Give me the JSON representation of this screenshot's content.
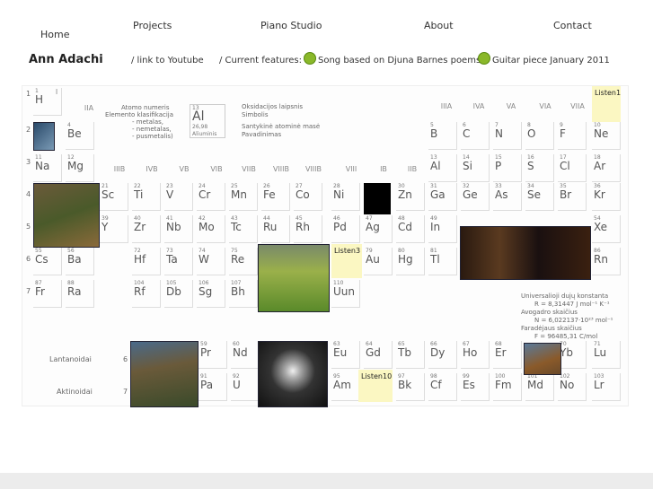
{
  "nav": {
    "home": "Home",
    "projects": "Projects",
    "piano": "Piano Studio",
    "about": "About",
    "contact": "Contact"
  },
  "header": {
    "name": "Ann Adachi",
    "youtube": "/ link to Youtube",
    "features_label": "/ Current features:",
    "feature1": "Song based on Djuna Barnes poems",
    "feature2": "Guitar piece January 2011"
  },
  "legend": {
    "atomic_number": "Atomo numeris",
    "classification": "Elemento klasifikacija",
    "metals": "- metalas,",
    "nonmetals": "- nemetalas,",
    "semimetals": "- pusmetalis)",
    "oxidation": "Oksidacijos laipsnis",
    "symbol_label": "Simbolis",
    "mass": "Santykinė atominė masė",
    "name_label": "Pavadinimas",
    "sample_symbol": "Al",
    "sample_number": "13",
    "sample_mass": "26,98",
    "sample_name": "Aliuminis"
  },
  "groups": [
    "I",
    "IIA",
    "IIIB",
    "IVB",
    "VB",
    "VIB",
    "VIIB",
    "VIIIB",
    "VIIIB",
    "VIII",
    "IB",
    "IIB",
    "IIIA",
    "IVA",
    "VA",
    "VIA",
    "VIIA"
  ],
  "periods": [
    "1",
    "2",
    "3",
    "4",
    "5",
    "6",
    "7"
  ],
  "elements": [
    {
      "s": "H",
      "n": "1"
    },
    {
      "s": "Be",
      "n": "4"
    },
    {
      "s": "Na",
      "n": "11"
    },
    {
      "s": "Mg",
      "n": "12"
    },
    {
      "s": "Sc",
      "n": "21"
    },
    {
      "s": "Ti",
      "n": "22"
    },
    {
      "s": "V",
      "n": "23"
    },
    {
      "s": "Cr",
      "n": "24"
    },
    {
      "s": "Mn",
      "n": "25"
    },
    {
      "s": "Fe",
      "n": "26"
    },
    {
      "s": "Co",
      "n": "27"
    },
    {
      "s": "Ni",
      "n": "28"
    },
    {
      "s": "Zn",
      "n": "30"
    },
    {
      "s": "Ga",
      "n": "31"
    },
    {
      "s": "Ge",
      "n": "32"
    },
    {
      "s": "As",
      "n": "33"
    },
    {
      "s": "Se",
      "n": "34"
    },
    {
      "s": "Br",
      "n": "35"
    },
    {
      "s": "Kr",
      "n": "36"
    },
    {
      "s": "Y",
      "n": "39"
    },
    {
      "s": "Zr",
      "n": "40"
    },
    {
      "s": "Nb",
      "n": "41"
    },
    {
      "s": "Mo",
      "n": "42"
    },
    {
      "s": "Tc",
      "n": "43"
    },
    {
      "s": "Ru",
      "n": "44"
    },
    {
      "s": "Rh",
      "n": "45"
    },
    {
      "s": "Pd",
      "n": "46"
    },
    {
      "s": "Ag",
      "n": "47"
    },
    {
      "s": "Cd",
      "n": "48"
    },
    {
      "s": "In",
      "n": "49"
    },
    {
      "s": "Xe",
      "n": "54"
    },
    {
      "s": "Cs",
      "n": "55"
    },
    {
      "s": "Ba",
      "n": "56"
    },
    {
      "s": "Hf",
      "n": "72"
    },
    {
      "s": "Ta",
      "n": "73"
    },
    {
      "s": "W",
      "n": "74"
    },
    {
      "s": "Re",
      "n": "75"
    },
    {
      "s": "Au",
      "n": "79"
    },
    {
      "s": "Hg",
      "n": "80"
    },
    {
      "s": "Tl",
      "n": "81"
    },
    {
      "s": "Rn",
      "n": "86"
    },
    {
      "s": "Fr",
      "n": "87"
    },
    {
      "s": "Ra",
      "n": "88"
    },
    {
      "s": "Rf",
      "n": "104"
    },
    {
      "s": "Db",
      "n": "105"
    },
    {
      "s": "Sg",
      "n": "106"
    },
    {
      "s": "Bh",
      "n": "107"
    },
    {
      "s": "Uun",
      "n": "110"
    },
    {
      "s": "B",
      "n": "5"
    },
    {
      "s": "C",
      "n": "6"
    },
    {
      "s": "N",
      "n": "7"
    },
    {
      "s": "O",
      "n": "8"
    },
    {
      "s": "F",
      "n": "9"
    },
    {
      "s": "Ne",
      "n": "10"
    },
    {
      "s": "Al",
      "n": "13"
    },
    {
      "s": "Si",
      "n": "14"
    },
    {
      "s": "P",
      "n": "15"
    },
    {
      "s": "S",
      "n": "16"
    },
    {
      "s": "Cl",
      "n": "17"
    },
    {
      "s": "Ar",
      "n": "18"
    },
    {
      "s": "Pr",
      "n": "59"
    },
    {
      "s": "Nd",
      "n": "60"
    },
    {
      "s": "Eu",
      "n": "63"
    },
    {
      "s": "Gd",
      "n": "64"
    },
    {
      "s": "Tb",
      "n": "65"
    },
    {
      "s": "Dy",
      "n": "66"
    },
    {
      "s": "Ho",
      "n": "67"
    },
    {
      "s": "Er",
      "n": "68"
    },
    {
      "s": "Yb",
      "n": "70"
    },
    {
      "s": "Lu",
      "n": "71"
    },
    {
      "s": "Pa",
      "n": "91"
    },
    {
      "s": "U",
      "n": "92"
    },
    {
      "s": "Am",
      "n": "95"
    },
    {
      "s": "Bk",
      "n": "97"
    },
    {
      "s": "Cf",
      "n": "98"
    },
    {
      "s": "Es",
      "n": "99"
    },
    {
      "s": "Fm",
      "n": "100"
    },
    {
      "s": "Md",
      "n": "101"
    },
    {
      "s": "No",
      "n": "102"
    },
    {
      "s": "Lr",
      "n": "103"
    }
  ],
  "listen": {
    "l1": "Listen1",
    "l3": "Listen3",
    "l10": "Listen10"
  },
  "series": {
    "lanthanides": "Lantanoidai",
    "actinides": "Aktinoidai"
  },
  "constants": {
    "gas": "Universalioji dujų konstanta",
    "gas_val": "R = 8,31447 J mol⁻¹ K⁻¹",
    "avogadro": "Avogadro skaičius",
    "avogadro_val": "N = 6,022137·10²³ mol⁻¹",
    "faraday": "Faradėjaus skaičius",
    "faraday_val": "F = 96485,31 C/mol"
  }
}
